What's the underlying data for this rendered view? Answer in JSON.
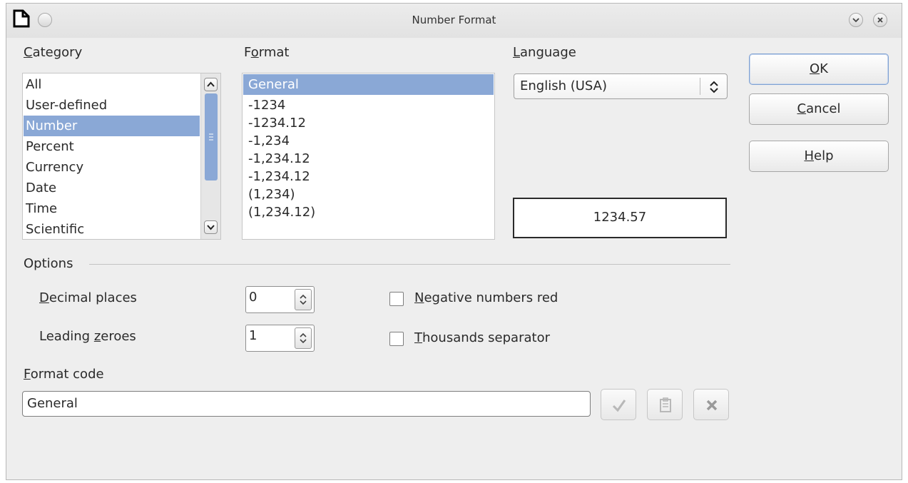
{
  "window": {
    "title": "Number Format"
  },
  "category": {
    "label_u": "C",
    "label_rest": "ategory",
    "items": [
      "All",
      "User-defined",
      "Number",
      "Percent",
      "Currency",
      "Date",
      "Time",
      "Scientific"
    ],
    "selected": "Number"
  },
  "format": {
    "label_a": "F",
    "label_u": "o",
    "label_rest": "rmat",
    "items": [
      "General",
      "-1234",
      "-1234.12",
      "-1,234",
      "-1,234.12",
      "-1,234.12",
      "(1,234)",
      "(1,234.12)"
    ],
    "selected": "General"
  },
  "language": {
    "label_u": "L",
    "label_rest": "anguage",
    "value": "English (USA)"
  },
  "preview": {
    "value": "1234.57"
  },
  "buttons": {
    "ok_u": "O",
    "ok_rest": "K",
    "cancel_u": "C",
    "cancel_rest": "ancel",
    "help_u": "H",
    "help_rest": "elp"
  },
  "options": {
    "heading": "Options",
    "decimal_u": "D",
    "decimal_rest": "ecimal places",
    "decimal_value": "0",
    "leading_a": "Leading ",
    "leading_u": "z",
    "leading_rest": "eroes",
    "leading_value": "1",
    "negative_u": "N",
    "negative_rest": "egative numbers red",
    "negative_checked": false,
    "thousands_u": "T",
    "thousands_rest": "housands separator",
    "thousands_checked": false
  },
  "format_code": {
    "label_u": "F",
    "label_rest": "ormat code",
    "value": "General"
  },
  "icons": {
    "app": "document-icon",
    "menu": "window-menu-icon",
    "minimize": "chevron-down-icon",
    "close": "close-icon",
    "accept": "checkmark-icon",
    "comment": "comment-icon",
    "delete": "delete-icon"
  },
  "colors": {
    "selection": "#8aa8d6",
    "dialog_bg": "#eeeeee"
  }
}
